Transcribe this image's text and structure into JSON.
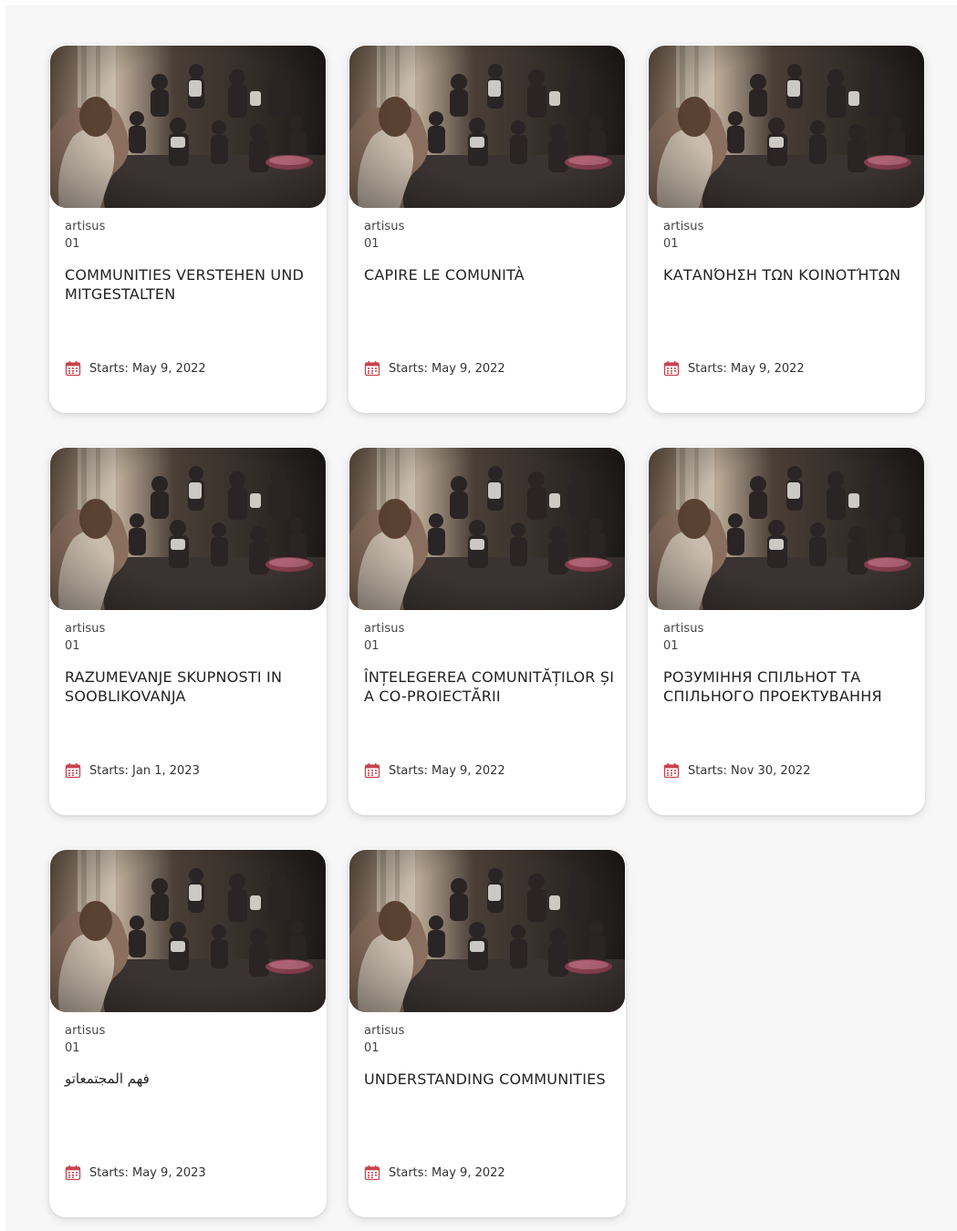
{
  "colors": {
    "accent": "#c9434f",
    "background": "#f7f7f7",
    "card": "#ffffff"
  },
  "cards": [
    {
      "provider": "artisus",
      "number": "01",
      "title": "COMMUNITIES VERSTEHEN UND MITGESTALTEN",
      "starts": "Starts: May 9, 2022",
      "image": "group-workshop-photo"
    },
    {
      "provider": "artisus",
      "number": "01",
      "title": "CAPIRE LE COMUNITÀ",
      "starts": "Starts: May 9, 2022",
      "image": "group-workshop-photo"
    },
    {
      "provider": "artisus",
      "number": "01",
      "title": "ΚΑΤΑΝΌΗΣΗ ΤΩΝ ΚΟΙΝΟΤΉΤΩΝ",
      "starts": "Starts: May 9, 2022",
      "image": "group-workshop-photo"
    },
    {
      "provider": "artisus",
      "number": "01",
      "title": "RAZUMEVANJE SKUPNOSTI IN SOOBLIKOVANJA",
      "starts": "Starts: Jan 1, 2023",
      "image": "group-workshop-photo"
    },
    {
      "provider": "artisus",
      "number": "01",
      "title": "ÎNȚELEGEREA COMUNITĂȚILOR ȘI A CO-PROIECTĂRII",
      "starts": "Starts: May 9, 2022",
      "image": "group-workshop-photo"
    },
    {
      "provider": "artisus",
      "number": "01",
      "title": "РОЗУМІННЯ СПІЛЬНОТ ТА СПІЛЬНОГО ПРОЕКТУВАННЯ",
      "starts": "Starts: Nov 30, 2022",
      "image": "group-workshop-photo"
    },
    {
      "provider": "artisus",
      "number": "01",
      "title": "فهم المجتمعاتو",
      "starts": "Starts: May 9, 2023",
      "image": "group-workshop-photo"
    },
    {
      "provider": "artisus",
      "number": "01",
      "title": "UNDERSTANDING COMMUNITIES",
      "starts": "Starts: May 9, 2022",
      "image": "group-workshop-photo"
    }
  ]
}
